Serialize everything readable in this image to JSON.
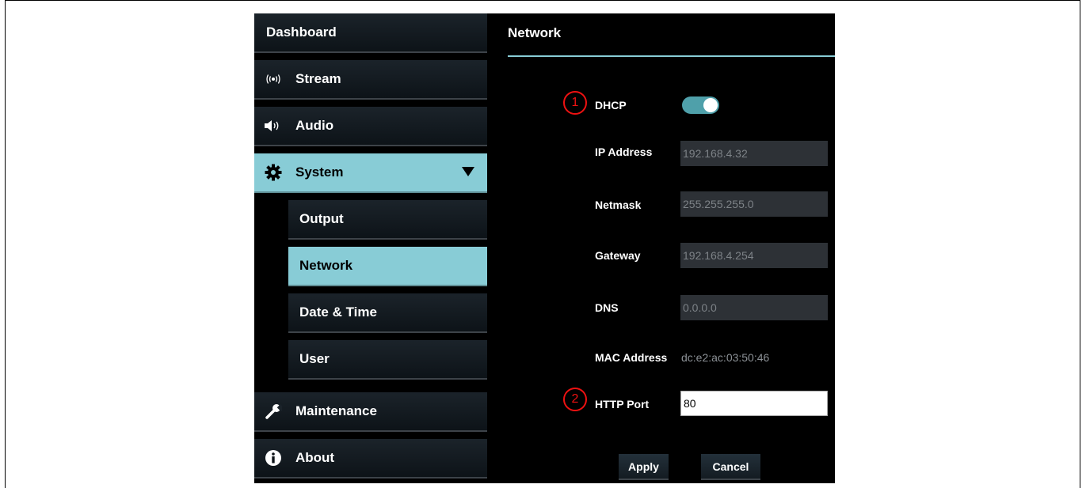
{
  "sidebar": {
    "dashboard": "Dashboard",
    "stream": "Stream",
    "audio": "Audio",
    "system": "System",
    "system_sub": {
      "output": "Output",
      "network": "Network",
      "date_time": "Date & Time",
      "user": "User"
    },
    "maintenance": "Maintenance",
    "about": "About"
  },
  "main": {
    "title": "Network",
    "dhcp_label": "DHCP",
    "dhcp_enabled": true,
    "ip_label": "IP Address",
    "ip_value": "192.168.4.32",
    "netmask_label": "Netmask",
    "netmask_value": "255.255.255.0",
    "gateway_label": "Gateway",
    "gateway_value": "192.168.4.254",
    "dns_label": "DNS",
    "dns_value": "0.0.0.0",
    "mac_label": "MAC Address",
    "mac_value": "dc:e2:ac:03:50:46",
    "http_port_label": "HTTP Port",
    "http_port_value": "80",
    "apply": "Apply",
    "cancel": "Cancel"
  },
  "markers": {
    "one": "1",
    "two": "2"
  },
  "colors": {
    "accent": "#88ccd6",
    "toggle_on": "#4fa0aa",
    "marker": "#ee1111"
  }
}
